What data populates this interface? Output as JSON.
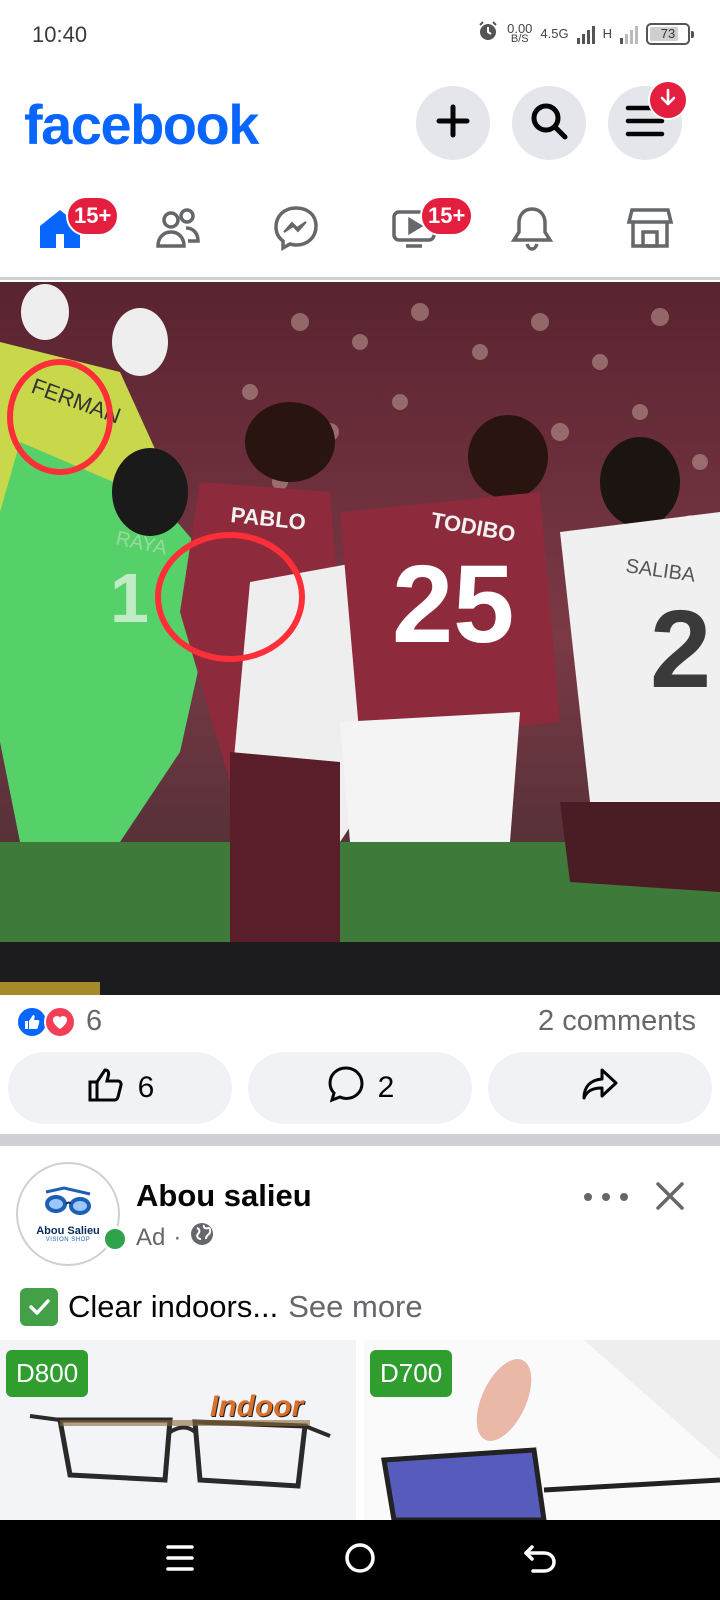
{
  "status_bar": {
    "time": "10:40",
    "net_speed_value": "0.00",
    "net_speed_unit": "B/S",
    "network_type": "4.5G",
    "network_h": "H",
    "battery": "73"
  },
  "header": {
    "logo": "facebook",
    "add_icon": "plus-icon",
    "search_icon": "search-icon",
    "menu_icon": "menu-icon",
    "menu_badge_icon": "download-arrow-icon"
  },
  "tabs": [
    {
      "name": "home",
      "icon": "home-icon",
      "badge": "15+",
      "active": true
    },
    {
      "name": "friends",
      "icon": "friends-icon",
      "badge": ""
    },
    {
      "name": "messenger",
      "icon": "messenger-icon",
      "badge": ""
    },
    {
      "name": "video",
      "icon": "video-icon",
      "badge": "15+"
    },
    {
      "name": "notifications",
      "icon": "bell-icon",
      "badge": ""
    },
    {
      "name": "marketplace",
      "icon": "marketplace-icon",
      "badge": ""
    }
  ],
  "post": {
    "image_labels": {
      "keeper_back": "RAYA",
      "keeper_number": "1",
      "player_a": "PABLO",
      "player_b": "TODIBO",
      "player_b_number": "25",
      "player_c": "SALIBA",
      "player_c_number": "2",
      "keeper_b": "FERMAN"
    },
    "reaction_count": "6",
    "comments_text": "2 comments",
    "like_count": "6",
    "comment_count": "2"
  },
  "ad": {
    "avatar_name": "Abou Salieu",
    "avatar_sub": "VISION SHOP",
    "name": "Abou salieu",
    "meta": "Ad",
    "text": "Clear indoors...",
    "see_more": "See more",
    "cards": [
      {
        "price": "D800",
        "overlay": "Indoor"
      },
      {
        "price": "D700"
      }
    ]
  },
  "colors": {
    "brand": "#0866ff",
    "badge": "#e41e3f",
    "online": "#31a24c",
    "price_tag": "#2f9e2f"
  }
}
